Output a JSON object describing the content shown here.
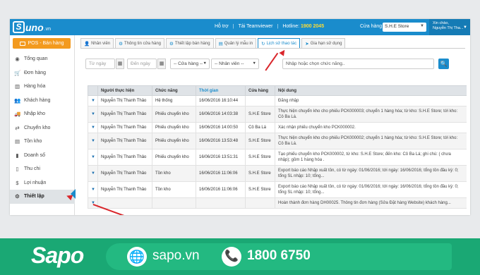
{
  "topbar": {
    "logo": {
      "mark": "S",
      "text": "uno",
      "suffix": ".vn"
    },
    "links": [
      "Hỗ trợ",
      "Tải Teamviewer"
    ],
    "hotline_label": "Hotline:",
    "hotline_number": "1900 2045",
    "store_label": "Cửa hàng",
    "store_value": "S.H.E Store",
    "greeting": "Xin chào,",
    "user_name": "Nguyễn Thị Tha..."
  },
  "sidebar": {
    "pos_button": "POS - Bán hàng",
    "items": [
      {
        "label": "Tổng quan",
        "icon": "dashboard-icon",
        "glyph": "◉"
      },
      {
        "label": "Đơn hàng",
        "icon": "cart-icon",
        "glyph": "🛒"
      },
      {
        "label": "Hàng hóa",
        "icon": "barcode-icon",
        "glyph": "▥"
      },
      {
        "label": "Khách hàng",
        "icon": "users-icon",
        "glyph": "👥"
      },
      {
        "label": "Nhập kho",
        "icon": "truck-icon",
        "glyph": "🚚"
      },
      {
        "label": "Chuyển kho",
        "icon": "transfer-icon",
        "glyph": "⇄"
      },
      {
        "label": "Tồn kho",
        "icon": "warehouse-icon",
        "glyph": "▤"
      },
      {
        "label": "Doanh số",
        "icon": "bar-chart-icon",
        "glyph": "▮"
      },
      {
        "label": "Thu chi",
        "icon": "book-icon",
        "glyph": "▯"
      },
      {
        "label": "Lợi nhuận",
        "icon": "dollar-icon",
        "glyph": "$"
      },
      {
        "label": "Thiết lập",
        "icon": "gears-icon",
        "glyph": "⚙"
      }
    ],
    "active_index": 10
  },
  "tabs": [
    {
      "label": "Nhân viên",
      "icon": "user-icon",
      "glyph": "👤"
    },
    {
      "label": "Thông tin cửa hàng",
      "icon": "gear-icon",
      "glyph": "⚙"
    },
    {
      "label": "Thiết lập bán hàng",
      "icon": "gears-icon",
      "glyph": "⚙"
    },
    {
      "label": "Quản lý mẫu in",
      "icon": "file-icon",
      "glyph": "▤"
    },
    {
      "label": "Lịch sử thao tác",
      "icon": "history-icon",
      "glyph": "↻"
    },
    {
      "label": "Gia hạn sử dụng",
      "icon": "send-icon",
      "glyph": "➤"
    }
  ],
  "active_tab": 4,
  "filters": {
    "from_date_placeholder": "Từ ngày",
    "to_date_placeholder": "Đến ngày",
    "store_select": "-- Cửa hàng --",
    "staff_select": "-- Nhân viên --",
    "function_placeholder": "Nhập hoặc chọn chức năng..",
    "calendar_glyph": "▦",
    "search_glyph": "🔍"
  },
  "table": {
    "headers": [
      "",
      "Người thực hiện",
      "Chức năng",
      "Thời gian",
      "Cửa hàng",
      "Nội dung"
    ],
    "toggle_glyph": "▼",
    "rows": [
      [
        "",
        "Nguyễn Thị Thanh Thảo",
        "Hệ thống",
        "16/06/2016 16:10:44",
        "",
        "Đăng nhập"
      ],
      [
        "",
        "Nguyễn Thị Thanh Thảo",
        "Phiếu chuyển kho",
        "16/06/2016 14:03:38",
        "S.H.E Store",
        "Thực hiện chuyển kho cho phiếu PCK000003; chuyển 1 hàng hóa; từ kho: S.H.E Store; tới kho: Cô Ba Lá."
      ],
      [
        "",
        "Nguyễn Thị Thanh Thảo",
        "Phiếu chuyển kho",
        "16/06/2016 14:00:50",
        "Cô Ba Lá",
        "Xác nhận phiếu chuyển kho PCK000002."
      ],
      [
        "",
        "Nguyễn Thị Thanh Thảo",
        "Phiếu chuyển kho",
        "16/06/2016 13:53:48",
        "S.H.E Store",
        "Thực hiện chuyển kho cho phiếu PCK000002; chuyển 1 hàng hóa; từ kho: S.H.E Store; tới kho: Cô Ba Lá."
      ],
      [
        "",
        "Nguyễn Thị Thanh Thảo",
        "Phiếu chuyển kho",
        "16/06/2016 13:51:31",
        "S.H.E Store",
        "Tạo phiếu chuyển kho PCK000002, từ kho: S.H.E Store; đến kho: Cô Ba Lá; ghi chú: ( chưa nhập); gồm 1 hàng hóa ."
      ],
      [
        "",
        "Nguyễn Thị Thanh Thảo",
        "Tồn kho",
        "16/06/2016 11:06:06",
        "S.H.E Store",
        "Export báo cáo Nhập xuất tồn, có từ ngày: 01/06/2016; tới ngày: 16/06/2016; tổng tồn đầu kỳ: 0; tổng SL nhập: 10; tổng..."
      ],
      [
        "",
        "Nguyễn Thị Thanh Thảo",
        "Tồn kho",
        "16/06/2016 11:06:06",
        "S.H.E Store",
        "Export báo cáo Nhập xuất tồn, có từ ngày: 01/06/2016; tới ngày: 16/06/2016; tổng tồn đầu kỳ: 0; tổng SL nhập: 10; tổng..."
      ],
      [
        "",
        "",
        "",
        "",
        "",
        "Hoàn thành đơn hàng DH00025. Thông tin đơn hàng (Sửa Đặt hàng Website) khách hàng..."
      ]
    ]
  },
  "footer": {
    "brand": "Sapo",
    "website": "sapo.vn",
    "phone": "1800 6750",
    "globe_glyph": "🌐",
    "phone_glyph": "📞"
  }
}
